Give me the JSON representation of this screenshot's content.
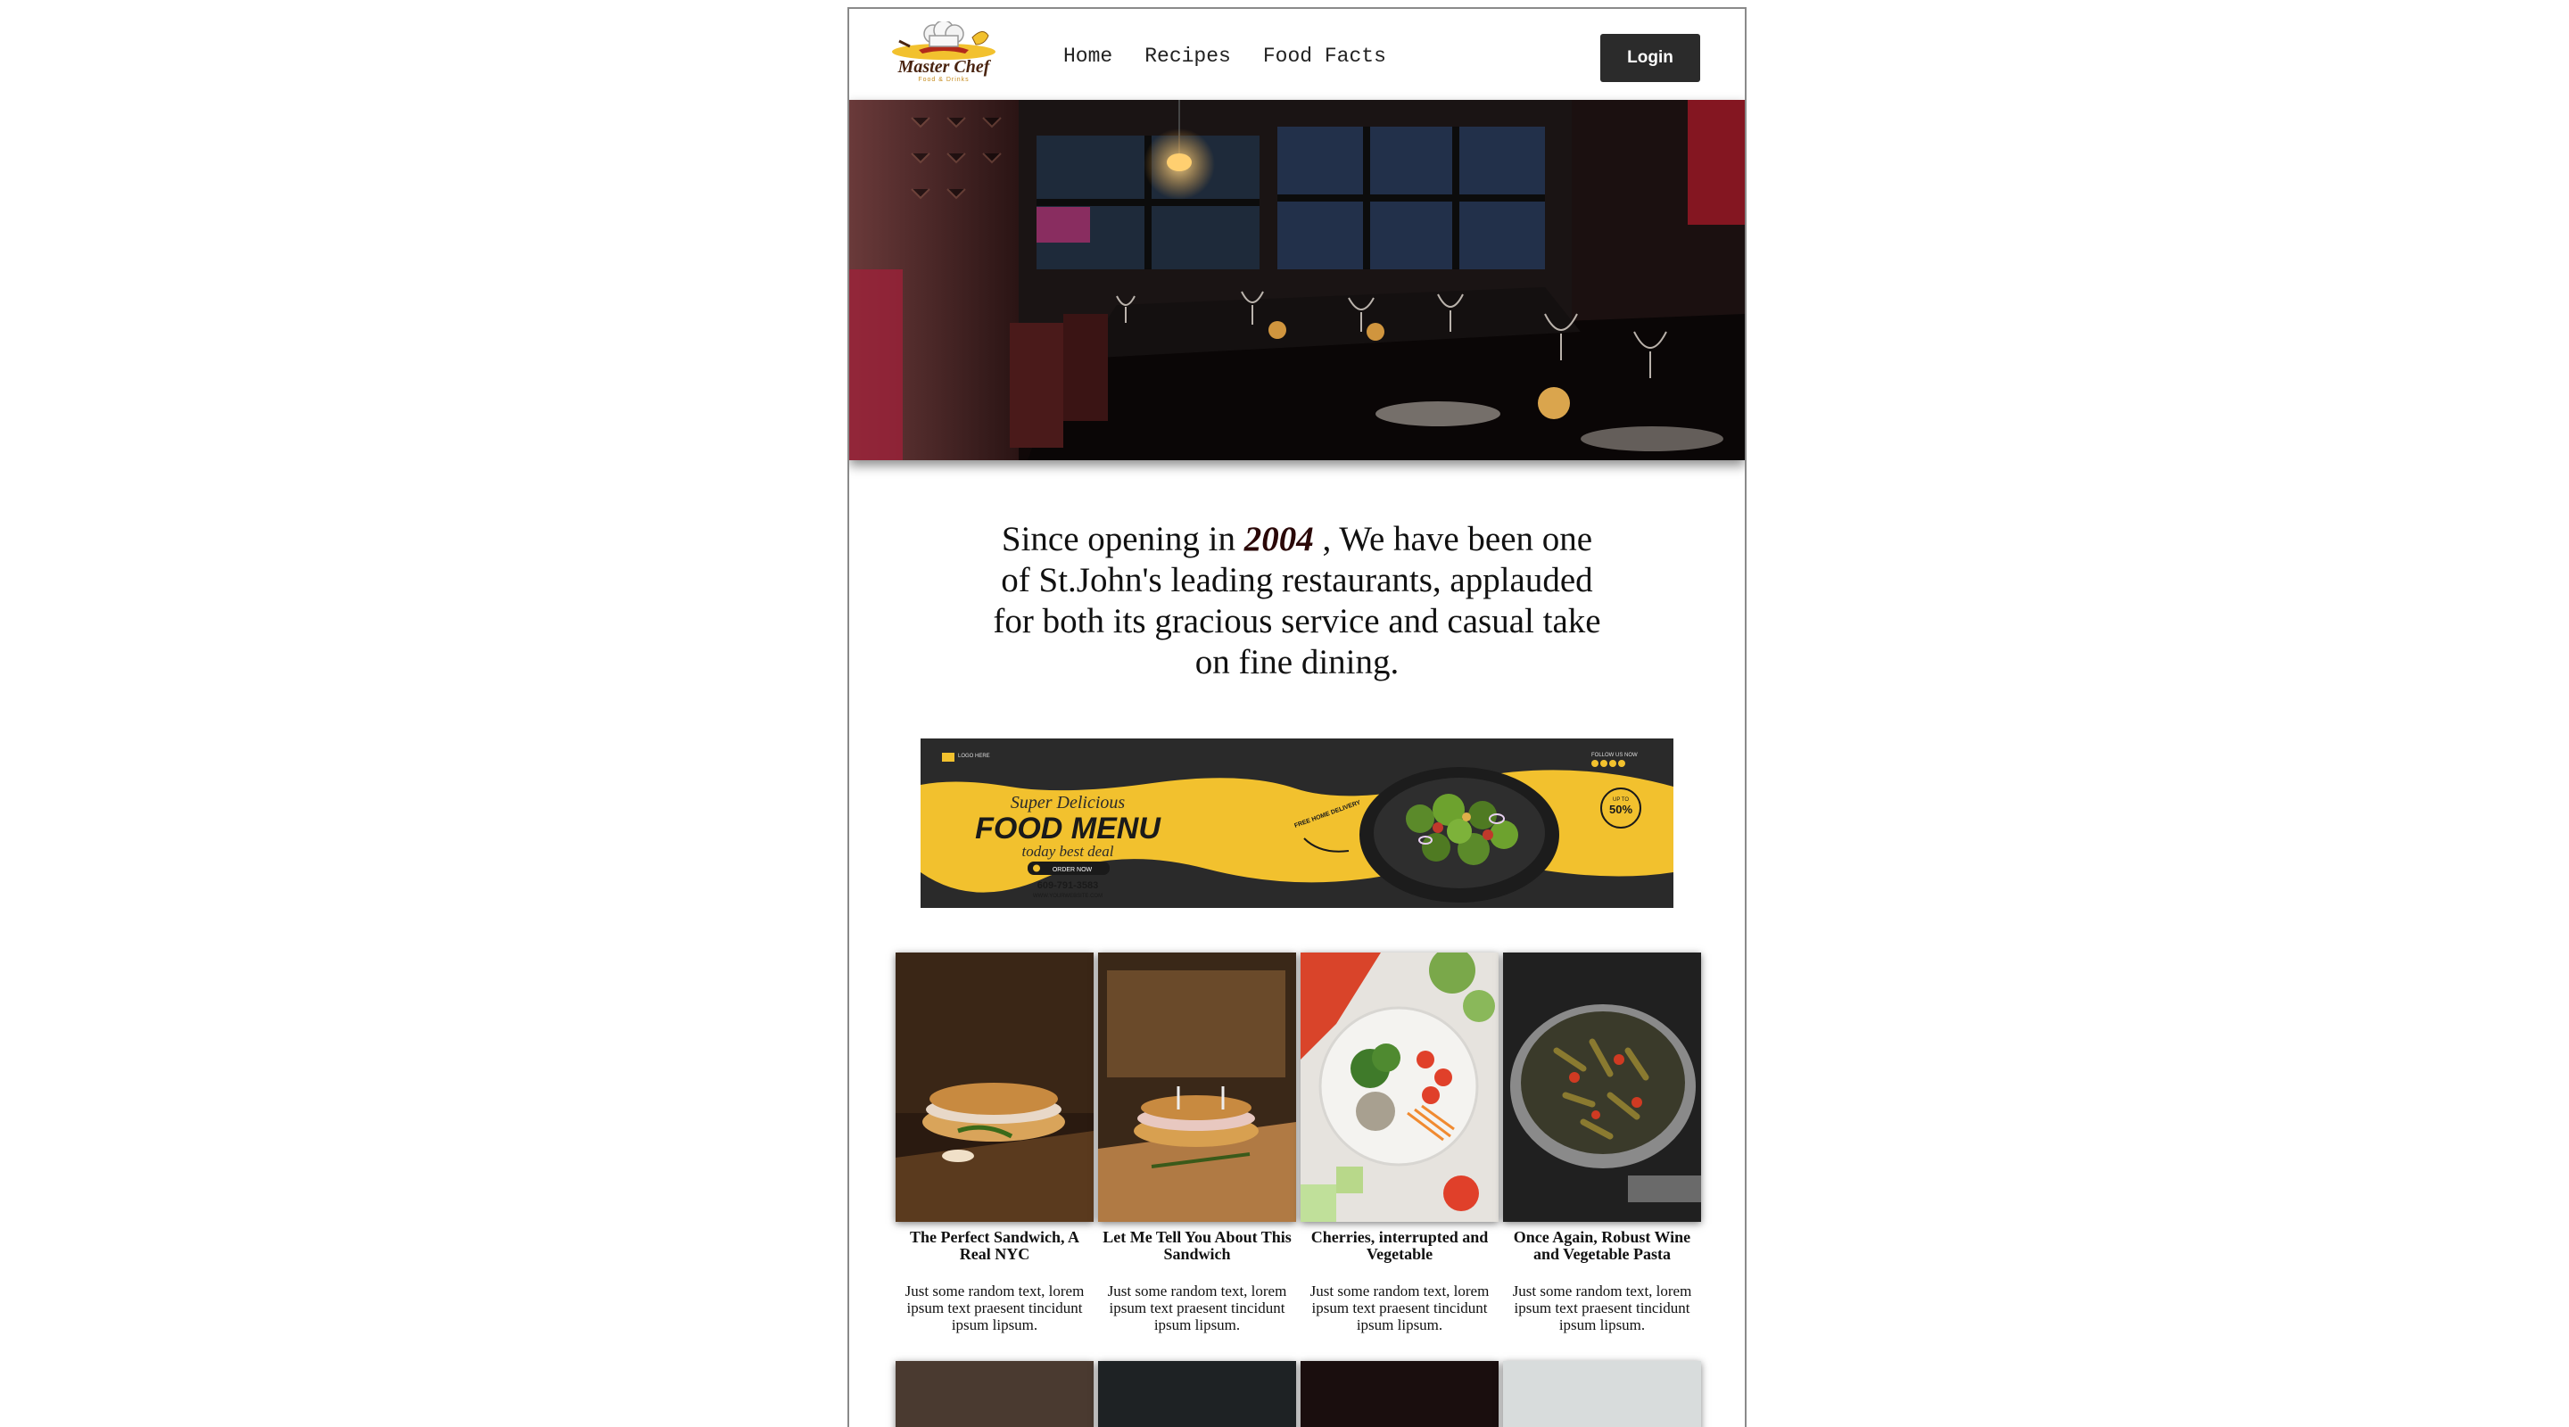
{
  "brand": {
    "name": "Master Chef",
    "tagline": "Food & Drinks"
  },
  "nav": {
    "links": [
      "Home",
      "Recipes",
      "Food Facts"
    ],
    "login_label": "Login"
  },
  "intro": {
    "before_year": "Since opening in",
    "year": "2004",
    "after_year": ", We have been one of St.John's leading restaurants, applauded for both its gracious service and casual take on fine dining."
  },
  "banner": {
    "logo_text": "LOGO HERE",
    "follow_text": "FOLLOW US NOW",
    "script_title": "Super Delicious",
    "main_title": "FOOD MENU",
    "sub_title": "today best deal",
    "order_label": "ORDER NOW",
    "phone": "609-791-3583",
    "website": "WWW.YOURWEBSITE.COM",
    "delivery_text": "FREE HOME DELIVERY",
    "discount_value": "50%",
    "discount_label": "UP TO"
  },
  "cards": [
    {
      "title": "The Perfect Sandwich, A Real NYC",
      "text": "Just some random text, lorem ipsum text praesent tincidunt ipsum lipsum."
    },
    {
      "title": "Let Me Tell You About This Sandwich",
      "text": "Just some random text, lorem ipsum text praesent tincidunt ipsum lipsum."
    },
    {
      "title": "Cherries, interrupted and Vegetable",
      "text": "Just some random text, lorem ipsum text praesent tincidunt ipsum lipsum."
    },
    {
      "title": "Once Again, Robust Wine and Vegetable Pasta",
      "text": "Just some random text, lorem ipsum text praesent tincidunt ipsum lipsum."
    }
  ],
  "colors": {
    "login_bg": "#2b2b2b",
    "banner_yellow": "#f2c12e",
    "banner_dark": "#2a2a2a",
    "accent_year": "#2a0808"
  }
}
